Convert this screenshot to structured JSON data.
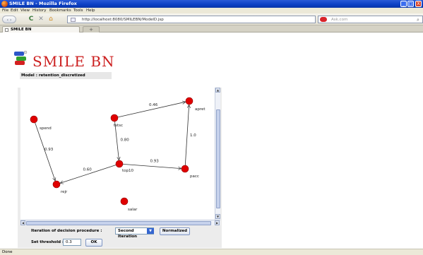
{
  "window": {
    "title": "SMILE BN - Mozilla Firefox",
    "controls": {
      "minimize": "_",
      "maximize": "□",
      "close": "X"
    }
  },
  "menu": {
    "items": [
      "File",
      "Edit",
      "View",
      "History",
      "Bookmarks",
      "Tools",
      "Help"
    ]
  },
  "toolbar": {
    "back_forward": "‹ ›",
    "reload": "C",
    "stop": "✕",
    "home": "⌂",
    "url": "http://localhost:8080/SMILEBN/ModelD.jsp",
    "go": "→",
    "dropdown": "▾",
    "search_placeholder": "Ask.com",
    "search_icon": "magnifier-icon"
  },
  "tabs": {
    "active_label": "SMILE BN",
    "new_tab": "+"
  },
  "app": {
    "logo_text": "SMILE BN",
    "model_label": "Model : retention_discretized"
  },
  "network": {
    "nodes": [
      {
        "id": "spend",
        "label": "spend"
      },
      {
        "id": "tstsc",
        "label": "tstsc"
      },
      {
        "id": "apret",
        "label": "apret"
      },
      {
        "id": "top10",
        "label": "top10"
      },
      {
        "id": "pacc",
        "label": "pacc"
      },
      {
        "id": "rejr",
        "label": "rejr"
      },
      {
        "id": "salar",
        "label": "salar"
      }
    ],
    "edges": [
      {
        "from": "tstsc",
        "to": "apret",
        "weight": "0.46"
      },
      {
        "from": "spend",
        "to": "rejr",
        "weight": "0.93"
      },
      {
        "from": "tstsc",
        "to": "top10",
        "weight": "0.80"
      },
      {
        "from": "top10",
        "to": "rejr",
        "weight": "0.60"
      },
      {
        "from": "top10",
        "to": "pacc",
        "weight": "0.93"
      },
      {
        "from": "pacc",
        "to": "apret",
        "weight": "1.0"
      }
    ],
    "node_color": "#e00000"
  },
  "controls": {
    "iteration_label": "Iteration of decision procedure :",
    "iteration_value": "Second Iteration",
    "normalized_button": "Normalized",
    "threshold_label": "Set threshold :",
    "threshold_value": "0.3",
    "ok_button": "OK"
  },
  "status": {
    "text": "Done"
  }
}
